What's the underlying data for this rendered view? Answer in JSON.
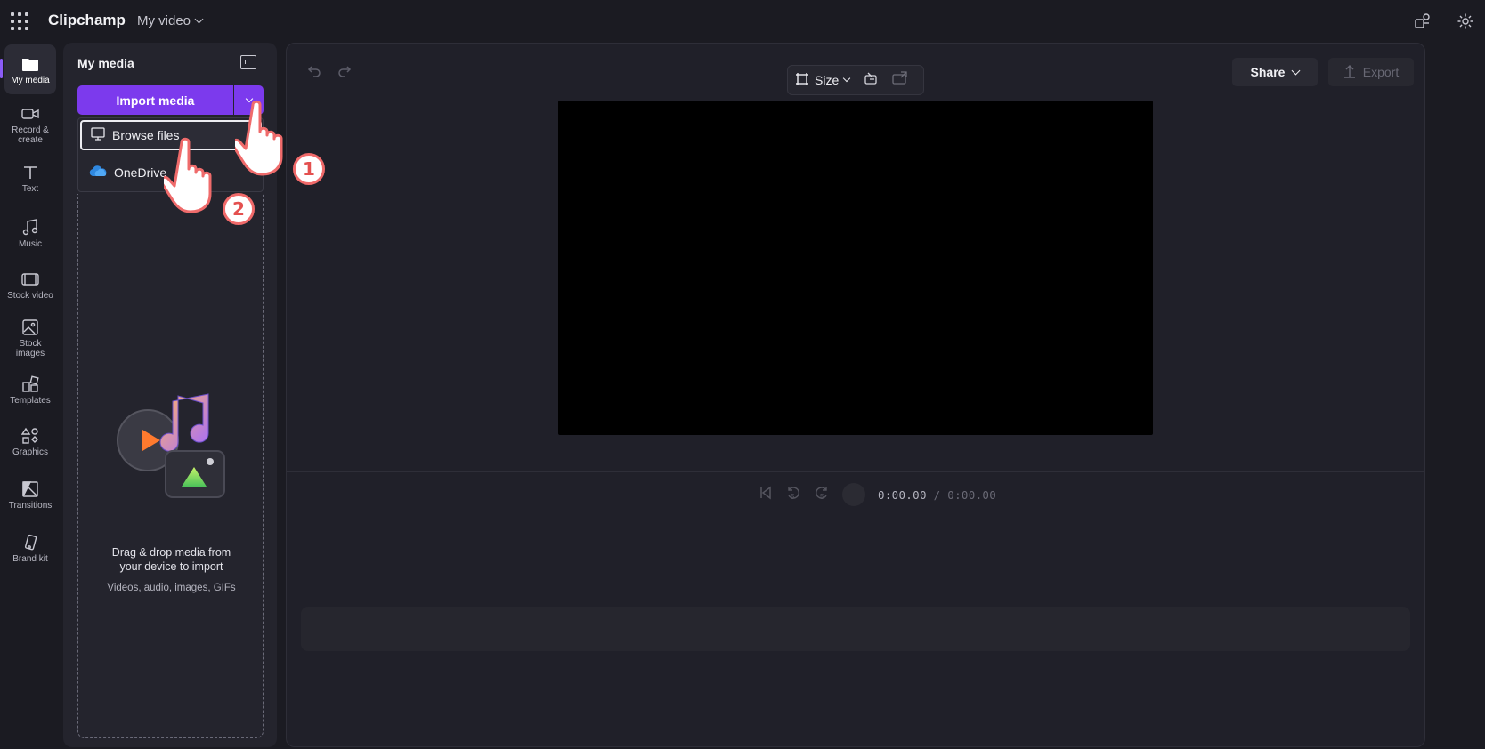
{
  "app": {
    "brand": "Clipchamp",
    "project_title": "My video"
  },
  "rail": {
    "items": [
      {
        "label": "My media",
        "icon": "folder-icon",
        "active": true
      },
      {
        "label": "Record &\ncreate",
        "icon": "camera-icon"
      },
      {
        "label": "Text",
        "icon": "text-icon"
      },
      {
        "label": "Music",
        "icon": "music-icon"
      },
      {
        "label": "Stock video",
        "icon": "film-icon"
      },
      {
        "label": "Stock\nimages",
        "icon": "image-icon"
      },
      {
        "label": "Templates",
        "icon": "templates-icon"
      },
      {
        "label": "Graphics",
        "icon": "shapes-icon"
      },
      {
        "label": "Transitions",
        "icon": "transitions-icon"
      },
      {
        "label": "Brand kit",
        "icon": "brand-kit-icon"
      }
    ]
  },
  "media_panel": {
    "title": "My media",
    "import_label": "Import media",
    "menu": [
      {
        "label": "Browse files",
        "icon": "monitor-icon"
      },
      {
        "label": "OneDrive",
        "icon": "onedrive-icon"
      }
    ],
    "drop_title": "Drag & drop media from your device to import",
    "drop_subtitle": "Videos, audio, images, GIFs"
  },
  "toolbar": {
    "size_label": "Size",
    "share_label": "Share",
    "export_label": "Export"
  },
  "playback": {
    "current_time": "0:00.00",
    "total_time": "/ 0:00.00",
    "skip_seconds": "5"
  },
  "annotations": {
    "step1": "1",
    "step2": "2"
  },
  "colors": {
    "accent": "#7c3aed",
    "badge_border": "#f06a6a"
  }
}
